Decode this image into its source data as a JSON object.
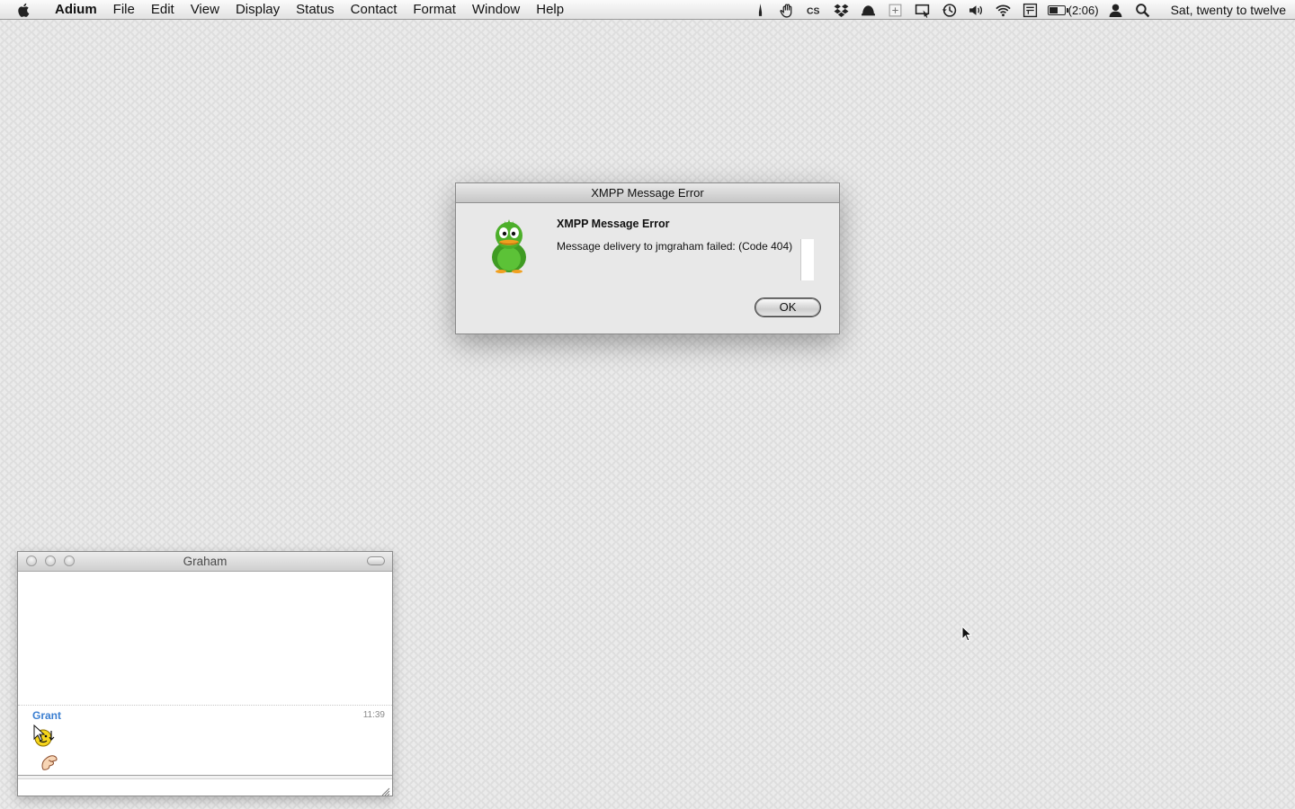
{
  "menubar": {
    "apple_icon": "apple-icon",
    "items": [
      "Adium",
      "File",
      "Edit",
      "View",
      "Display",
      "Status",
      "Contact",
      "Format",
      "Window",
      "Help"
    ],
    "status_icons": [
      "pen-icon",
      "hand-icon",
      "cs-icon",
      "dropbox-icon",
      "growl-icon",
      "input-icon",
      "screen-icon",
      "time-machine-icon",
      "volume-icon",
      "wifi-icon",
      "keyboard-icon"
    ],
    "battery": {
      "label": "(2:06)",
      "charge": 0.6
    },
    "user_icon": "user-icon",
    "search_icon": "spotlight-icon",
    "clock": "Sat, twenty to twelve"
  },
  "dialog": {
    "window_title": "XMPP Message Error",
    "heading": "XMPP Message Error",
    "message": "Message delivery to jmgraham failed: (Code 404)",
    "ok_label": "OK",
    "icon": "adium-duck-icon"
  },
  "chat": {
    "window_title": "Graham",
    "messages": [
      {
        "sender": "Grant",
        "time": "11:39",
        "content_icons": [
          "smiley-emoticon-icon",
          "hand-emoticon-icon"
        ]
      }
    ],
    "input_value": ""
  },
  "colors": {
    "sender_name": "#3b7fd1",
    "duck_green": "#4caf2a",
    "duck_beak": "#f0a020"
  }
}
